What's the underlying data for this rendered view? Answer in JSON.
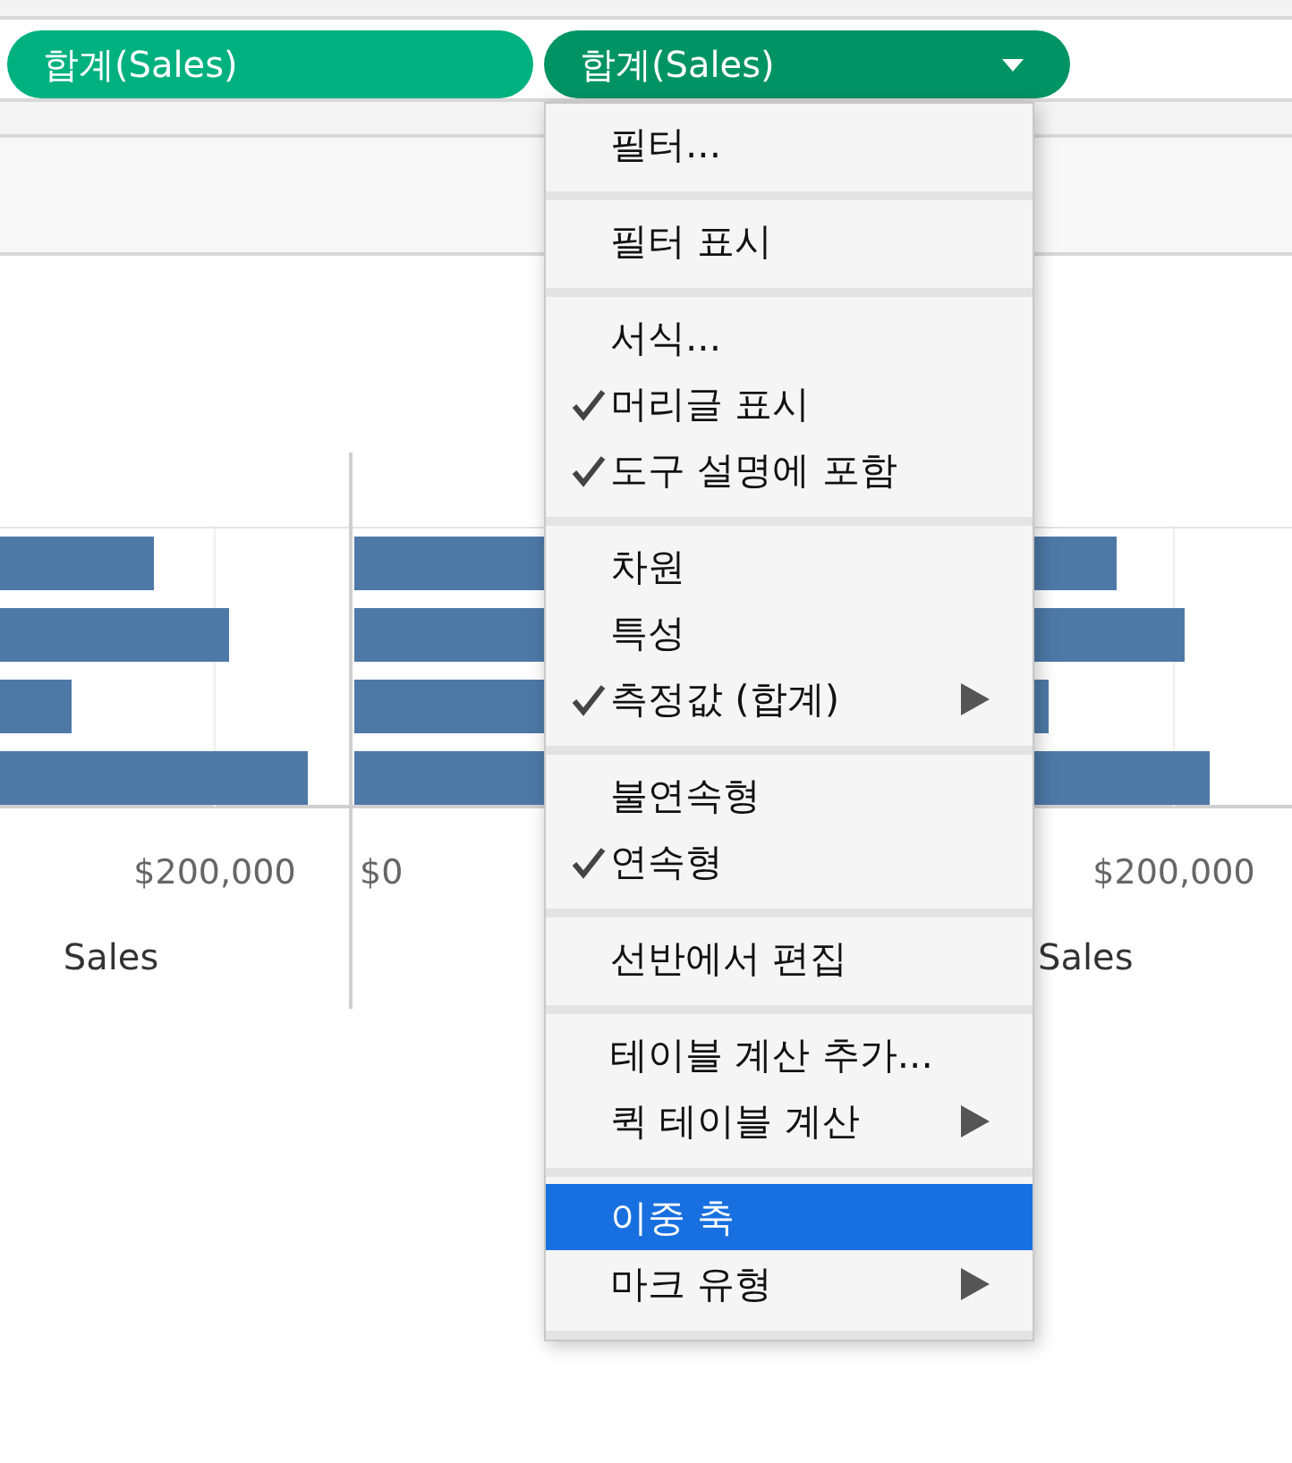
{
  "shelf_pills": [
    {
      "label": "합계(Sales)",
      "selected": false
    },
    {
      "label": "합계(Sales)",
      "selected": true
    }
  ],
  "chart": {
    "axis_labels_left": [
      "$200,000"
    ],
    "axis_labels_middle": [
      "$0"
    ],
    "axis_labels_right": [
      "$200,000"
    ],
    "axis_title_left": "Sales",
    "axis_title_right": "Sales"
  },
  "context_menu": {
    "groups": [
      {
        "items": [
          {
            "label": "필터...",
            "checked": false,
            "submenu": false,
            "selected": false
          }
        ]
      },
      {
        "items": [
          {
            "label": "필터 표시",
            "checked": false,
            "submenu": false,
            "selected": false
          }
        ]
      },
      {
        "items": [
          {
            "label": "서식...",
            "checked": false,
            "submenu": false,
            "selected": false
          },
          {
            "label": "머리글 표시",
            "checked": true,
            "submenu": false,
            "selected": false
          },
          {
            "label": "도구 설명에 포함",
            "checked": true,
            "submenu": false,
            "selected": false
          }
        ]
      },
      {
        "items": [
          {
            "label": "차원",
            "checked": false,
            "submenu": false,
            "selected": false
          },
          {
            "label": "특성",
            "checked": false,
            "submenu": false,
            "selected": false
          },
          {
            "label": "측정값 (합계)",
            "checked": true,
            "submenu": true,
            "selected": false
          }
        ]
      },
      {
        "items": [
          {
            "label": "불연속형",
            "checked": false,
            "submenu": false,
            "selected": false
          },
          {
            "label": "연속형",
            "checked": true,
            "submenu": false,
            "selected": false
          }
        ]
      },
      {
        "items": [
          {
            "label": "선반에서 편집",
            "checked": false,
            "submenu": false,
            "selected": false
          }
        ]
      },
      {
        "items": [
          {
            "label": "테이블 계산 추가...",
            "checked": false,
            "submenu": false,
            "selected": false
          },
          {
            "label": "퀵 테이블 계산",
            "checked": false,
            "submenu": true,
            "selected": false
          }
        ]
      },
      {
        "items": [
          {
            "label": "이중 축",
            "checked": false,
            "submenu": false,
            "selected": true
          },
          {
            "label": "마크 유형",
            "checked": false,
            "submenu": true,
            "selected": false
          }
        ]
      }
    ]
  }
}
